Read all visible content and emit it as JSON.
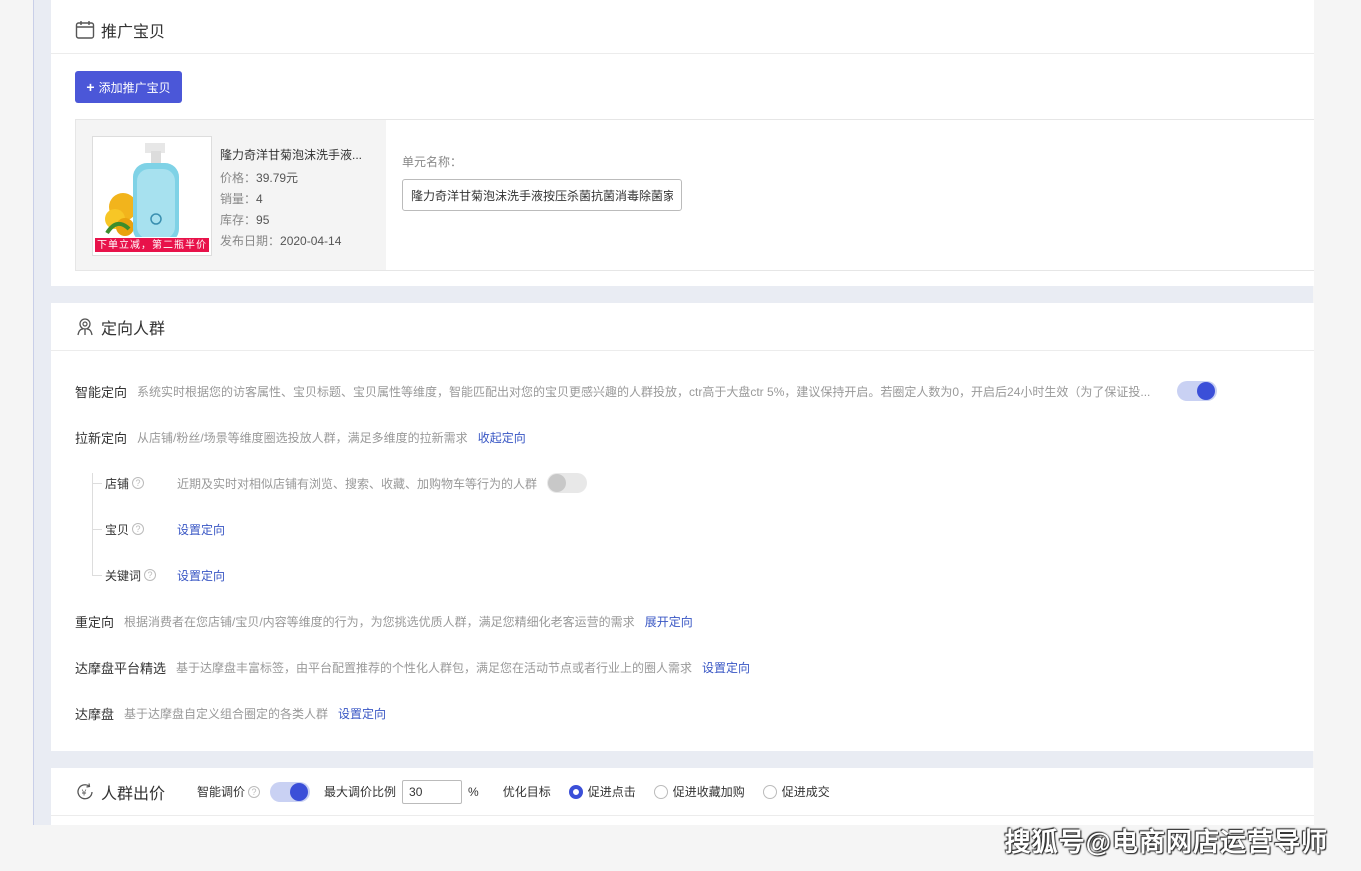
{
  "promo": {
    "title": "推广宝贝",
    "add_button": "添加推广宝贝",
    "item": {
      "name": "隆力奇洋甘菊泡沫洗手液...",
      "price_label": "价格：",
      "price_value": "39.79元",
      "sales_label": "销量：",
      "sales_value": "4",
      "stock_label": "库存：",
      "stock_value": "95",
      "date_label": "发布日期：",
      "date_value": "2020-04-14",
      "banner": "下单立减，第二瓶半价"
    },
    "unit_label": "单元名称：",
    "unit_value": "隆力奇洋甘菊泡沫洗手液按压杀菌抗菌消毒除菌家"
  },
  "target": {
    "title": "定向人群",
    "smart": {
      "label": "智能定向",
      "desc": "系统实时根据您的访客属性、宝贝标题、宝贝属性等维度，智能匹配出对您的宝贝更感兴趣的人群投放，ctr高于大盘ctr 5%，建议保持开启。若圈定人数为0，开启后24小时生效（为了保证投...",
      "enabled": true
    },
    "new": {
      "label": "拉新定向",
      "desc": "从店铺/粉丝/场景等维度圈选投放人群，满足多维度的拉新需求",
      "link": "收起定向"
    },
    "sub": {
      "shop_label": "店铺",
      "shop_desc": "近期及实时对相似店铺有浏览、搜索、收藏、加购物车等行为的人群",
      "shop_enabled": false,
      "item_label": "宝贝",
      "item_link": "设置定向",
      "keyword_label": "关键词",
      "keyword_link": "设置定向"
    },
    "retarget": {
      "label": "重定向",
      "desc": "根据消费者在您店铺/宝贝/内容等维度的行为，为您挑选优质人群，满足您精细化老客运营的需求",
      "link": "展开定向"
    },
    "dmp_select": {
      "label": "达摩盘平台精选",
      "desc": "基于达摩盘丰富标签，由平台配置推荐的个性化人群包，满足您在活动节点或者行业上的圈人需求",
      "link": "设置定向"
    },
    "dmp": {
      "label": "达摩盘",
      "desc": "基于达摩盘自定义组合圈定的各类人群",
      "link": "设置定向"
    }
  },
  "bid": {
    "title": "人群出价",
    "smart_label": "智能调价",
    "smart_enabled": true,
    "max_label": "最大调价比例",
    "max_value": "30",
    "percent": "%",
    "goal_label": "优化目标",
    "options": [
      "促进点击",
      "促进收藏加购",
      "促进成交"
    ],
    "selected": 0
  },
  "watermark": "搜狐号@电商网店运营导师",
  "colors": {
    "accent": "#4b57d8",
    "link": "#3856c4",
    "banner": "#e8124a"
  }
}
